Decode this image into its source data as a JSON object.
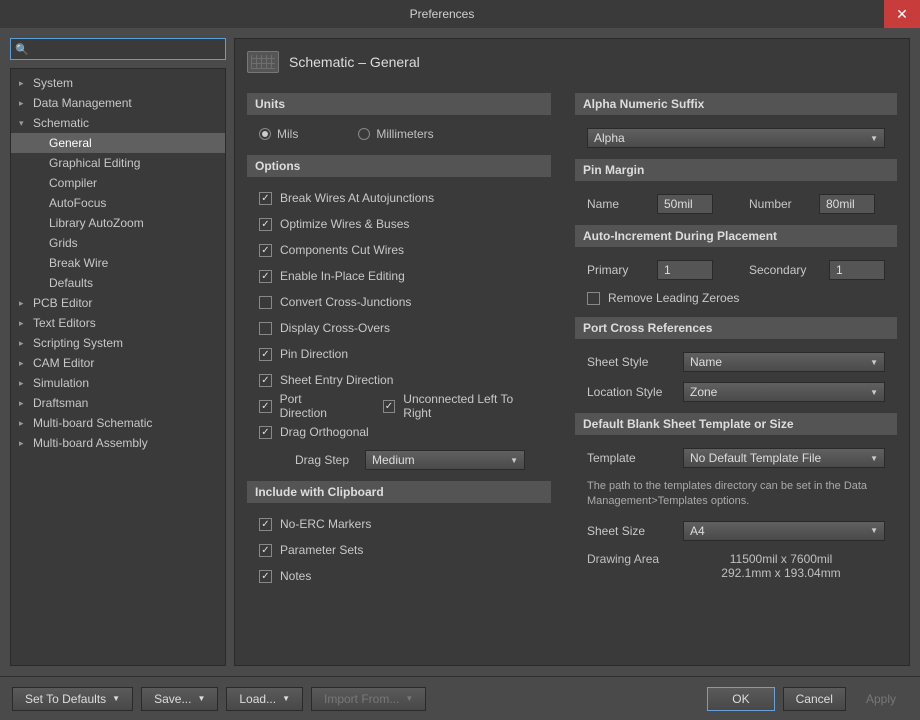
{
  "window": {
    "title": "Preferences"
  },
  "search": {
    "placeholder": ""
  },
  "tree": {
    "items": [
      {
        "label": "System",
        "expanded": false,
        "level": 0
      },
      {
        "label": "Data Management",
        "expanded": false,
        "level": 0
      },
      {
        "label": "Schematic",
        "expanded": true,
        "level": 0
      },
      {
        "label": "General",
        "level": 1,
        "selected": true
      },
      {
        "label": "Graphical Editing",
        "level": 1
      },
      {
        "label": "Compiler",
        "level": 1
      },
      {
        "label": "AutoFocus",
        "level": 1
      },
      {
        "label": "Library AutoZoom",
        "level": 1
      },
      {
        "label": "Grids",
        "level": 1
      },
      {
        "label": "Break Wire",
        "level": 1
      },
      {
        "label": "Defaults",
        "level": 1
      },
      {
        "label": "PCB Editor",
        "expanded": false,
        "level": 0
      },
      {
        "label": "Text Editors",
        "expanded": false,
        "level": 0
      },
      {
        "label": "Scripting System",
        "expanded": false,
        "level": 0
      },
      {
        "label": "CAM Editor",
        "expanded": false,
        "level": 0
      },
      {
        "label": "Simulation",
        "expanded": false,
        "level": 0
      },
      {
        "label": "Draftsman",
        "expanded": false,
        "level": 0
      },
      {
        "label": "Multi-board Schematic",
        "expanded": false,
        "level": 0
      },
      {
        "label": "Multi-board Assembly",
        "expanded": false,
        "level": 0
      }
    ]
  },
  "panel": {
    "title": "Schematic – General"
  },
  "sections": {
    "units": {
      "title": "Units",
      "mils": "Mils",
      "mm": "Millimeters",
      "selected": "mils"
    },
    "options": {
      "title": "Options",
      "break_wires": "Break Wires At Autojunctions",
      "optimize": "Optimize Wires & Buses",
      "cut_wires": "Components Cut Wires",
      "inplace": "Enable In-Place Editing",
      "convert_cross": "Convert Cross-Junctions",
      "display_cross": "Display Cross-Overs",
      "pin_dir": "Pin Direction",
      "sheet_entry": "Sheet Entry Direction",
      "port_dir": "Port Direction",
      "unconnected": "Unconnected Left To Right",
      "drag_orth": "Drag Orthogonal",
      "drag_step_label": "Drag Step",
      "drag_step_value": "Medium"
    },
    "clipboard": {
      "title": "Include with Clipboard",
      "no_erc": "No-ERC Markers",
      "param_sets": "Parameter Sets",
      "notes": "Notes"
    },
    "alpha": {
      "title": "Alpha Numeric Suffix",
      "value": "Alpha"
    },
    "pin_margin": {
      "title": "Pin Margin",
      "name_label": "Name",
      "name_value": "50mil",
      "number_label": "Number",
      "number_value": "80mil"
    },
    "auto_inc": {
      "title": "Auto-Increment During Placement",
      "primary_label": "Primary",
      "primary_value": "1",
      "secondary_label": "Secondary",
      "secondary_value": "1",
      "remove_zero": "Remove Leading Zeroes"
    },
    "port_cross": {
      "title": "Port Cross References",
      "sheet_style_label": "Sheet Style",
      "sheet_style_value": "Name",
      "location_style_label": "Location Style",
      "location_style_value": "Zone"
    },
    "blank_sheet": {
      "title": "Default Blank Sheet Template or Size",
      "template_label": "Template",
      "template_value": "No Default Template File",
      "note": "The path to the templates directory can be set in the Data Management>Templates options.",
      "sheet_size_label": "Sheet Size",
      "sheet_size_value": "A4",
      "drawing_area_label": "Drawing Area",
      "drawing_area_mil": "11500mil x 7600mil",
      "drawing_area_mm": "292.1mm x 193.04mm"
    }
  },
  "footer": {
    "set_defaults": "Set To Defaults",
    "save": "Save...",
    "load": "Load...",
    "import": "Import From...",
    "ok": "OK",
    "cancel": "Cancel",
    "apply": "Apply"
  }
}
